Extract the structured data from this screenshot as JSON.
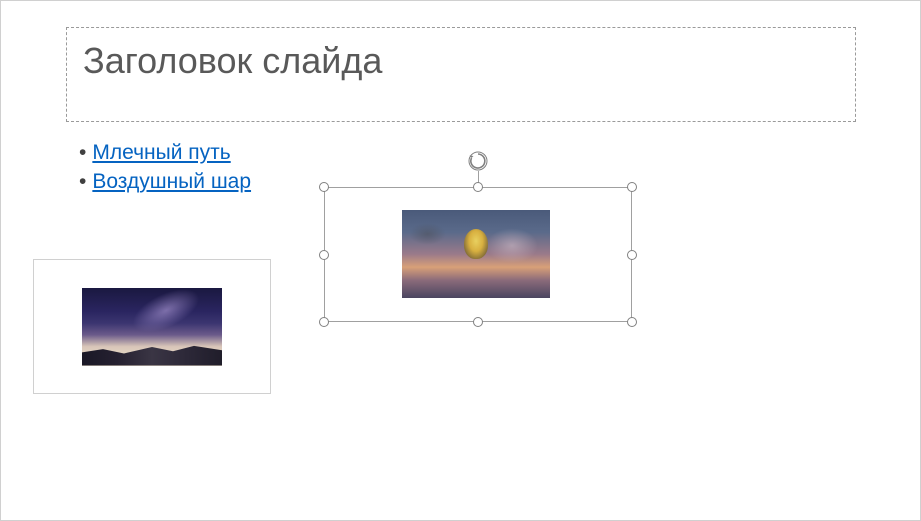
{
  "slide": {
    "title": "Заголовок слайда",
    "bullets": [
      {
        "text": "Млечный путь"
      },
      {
        "text": "Воздушный шар"
      }
    ],
    "images": {
      "milky_way_alt": "Млечный путь",
      "balloon_alt": "Воздушный шар"
    },
    "selected_object": "balloon-image"
  },
  "colors": {
    "link": "#0563C1",
    "title": "#595959",
    "border": "#a0a0a0"
  }
}
